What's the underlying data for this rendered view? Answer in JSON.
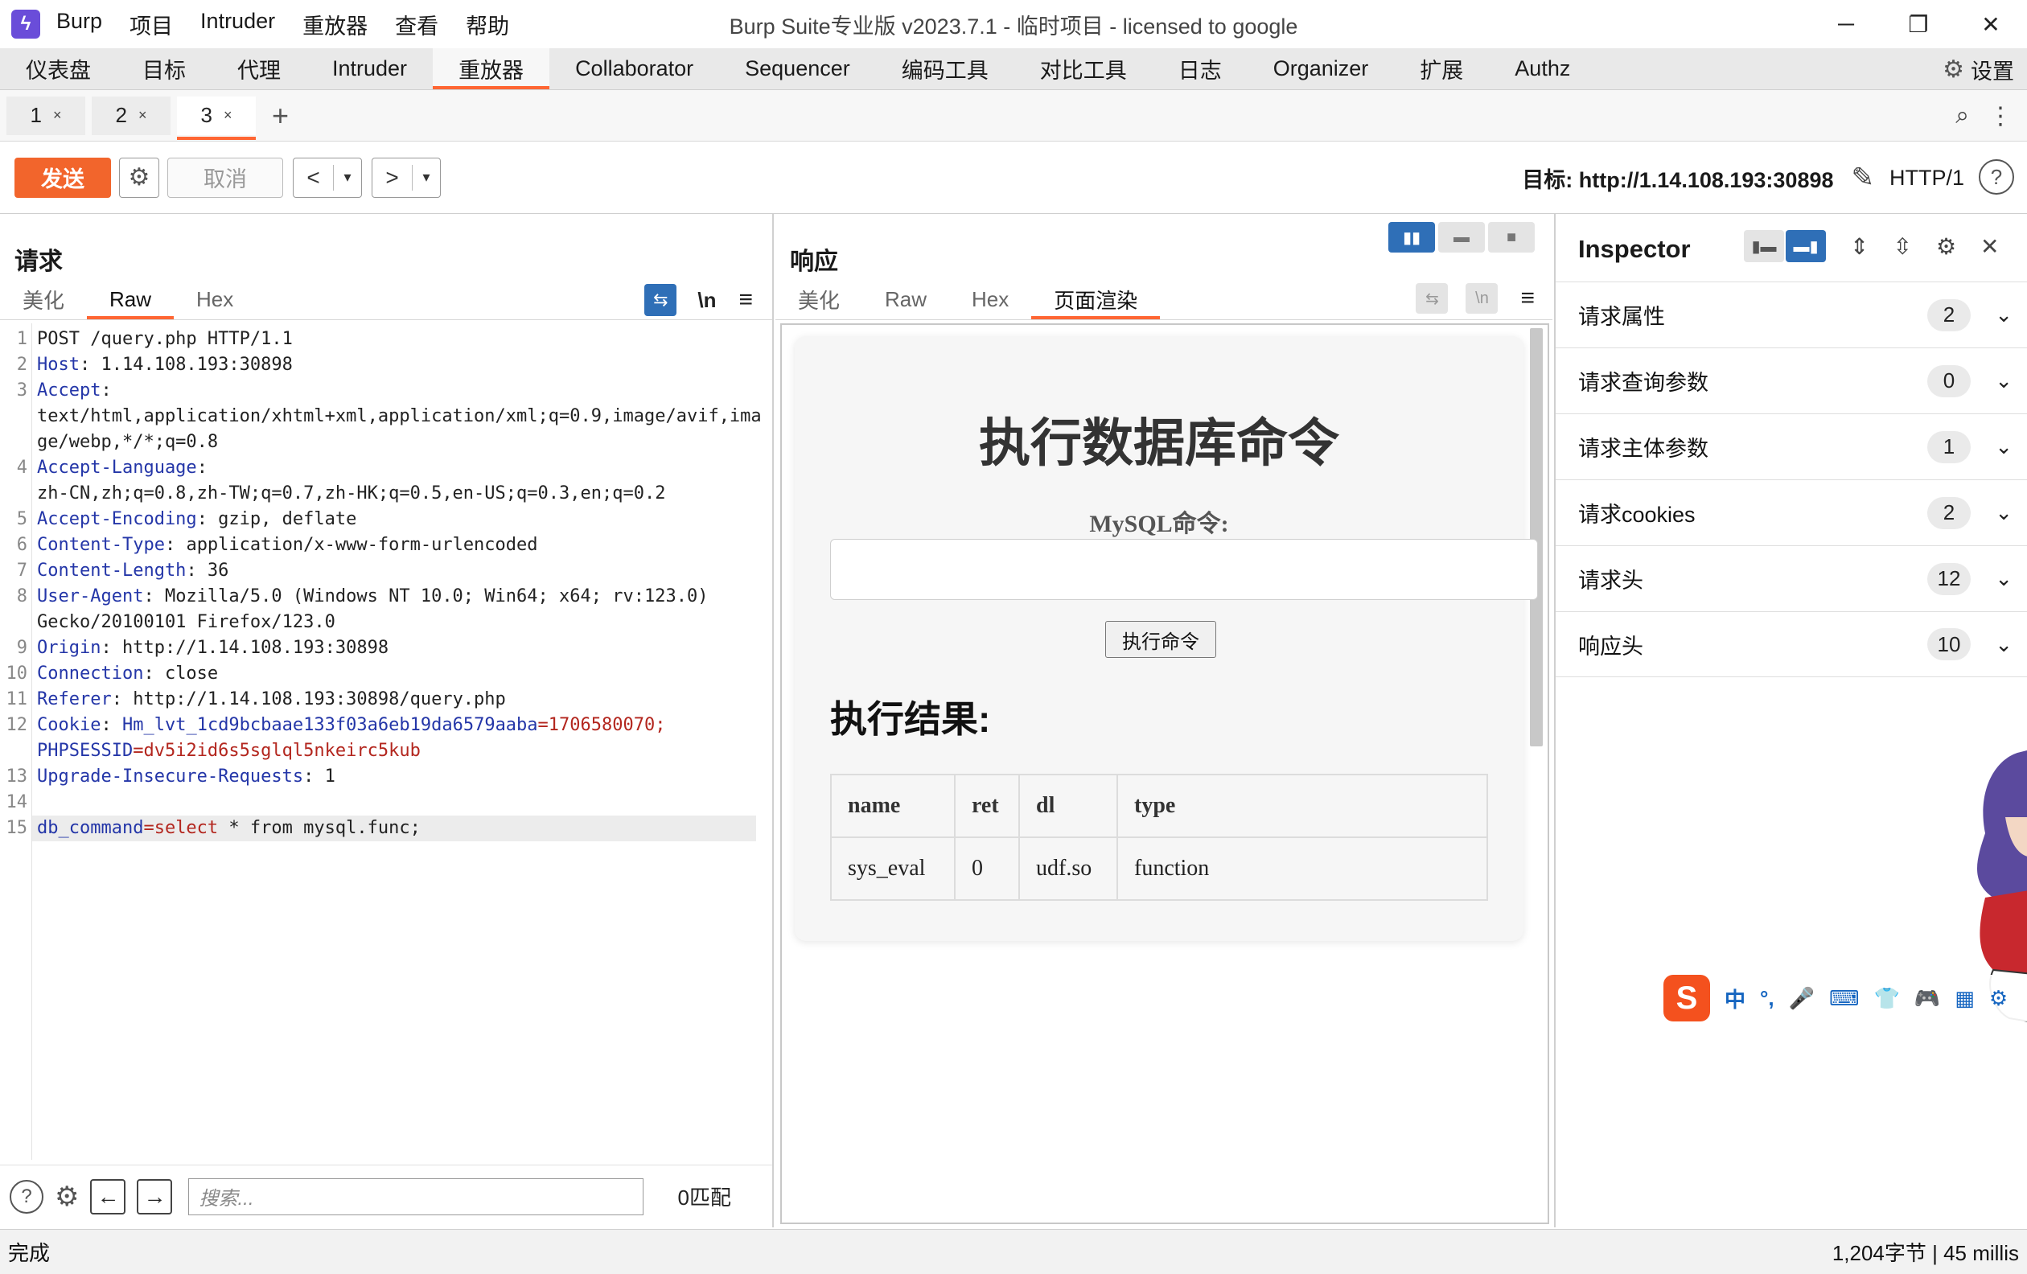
{
  "titlebar": {
    "app_icon": "burp-logo-icon",
    "menu": [
      "Burp",
      "项目",
      "Intruder",
      "重放器",
      "查看",
      "帮助"
    ],
    "window_title": "Burp Suite专业版  v2023.7.1 - 临时项目 - licensed to google",
    "controls": {
      "minimize": "─",
      "restore": "❐",
      "close": "✕"
    }
  },
  "main_tabs": [
    "仪表盘",
    "目标",
    "代理",
    "Intruder",
    "重放器",
    "Collaborator",
    "Sequencer",
    "编码工具",
    "对比工具",
    "日志",
    "Organizer",
    "扩展",
    "Authz"
  ],
  "main_tabs_active": "重放器",
  "settings_label": "设置",
  "repeater_tabs": [
    {
      "label": "1",
      "close": "×"
    },
    {
      "label": "2",
      "close": "×"
    },
    {
      "label": "3",
      "close": "×"
    }
  ],
  "repeater_add": "+",
  "toolbar": {
    "send": "发送",
    "cancel": "取消",
    "prev": "<",
    "next": ">",
    "dropdown": "▾",
    "target_label": "目标: http://1.14.108.193:30898",
    "http_version": "HTTP/1",
    "help": "?"
  },
  "request": {
    "title": "请求",
    "tabs": [
      "美化",
      "Raw",
      "Hex"
    ],
    "active_tab": "Raw",
    "tool_wrap": "⇆",
    "tool_newline": "\\n",
    "tool_menu": "≡",
    "lines": [
      {
        "n": "1",
        "text": "POST /query.php HTTP/1.1"
      },
      {
        "n": "2",
        "key": "Host",
        "val": ": 1.14.108.193:30898"
      },
      {
        "n": "3",
        "key": "Accept",
        "val": ":"
      },
      {
        "n": "",
        "text": "text/html,application/xhtml+xml,application/xml;q=0.9,image/avif,ima"
      },
      {
        "n": "",
        "text": "ge/webp,*/*;q=0.8"
      },
      {
        "n": "4",
        "key": "Accept-Language",
        "val": ":"
      },
      {
        "n": "",
        "text": "zh-CN,zh;q=0.8,zh-TW;q=0.7,zh-HK;q=0.5,en-US;q=0.3,en;q=0.2"
      },
      {
        "n": "5",
        "key": "Accept-Encoding",
        "val": ": gzip, deflate"
      },
      {
        "n": "6",
        "key": "Content-Type",
        "val": ": application/x-www-form-urlencoded"
      },
      {
        "n": "7",
        "key": "Content-Length",
        "val": ": 36"
      },
      {
        "n": "8",
        "key": "User-Agent",
        "val": ": Mozilla/5.0 (Windows NT 10.0; Win64; x64; rv:123.0)"
      },
      {
        "n": "",
        "text": "Gecko/20100101 Firefox/123.0"
      },
      {
        "n": "9",
        "key": "Origin",
        "val": ": http://1.14.108.193:30898"
      },
      {
        "n": "10",
        "key": "Connection",
        "val": ": close"
      },
      {
        "n": "11",
        "key": "Referer",
        "val": ": http://1.14.108.193:30898/query.php"
      },
      {
        "n": "12",
        "key": "Cookie",
        "val": ": ",
        "pk": "Hm_lvt_1cd9bcbaae133f03a6eb19da6579aaba",
        "pv": "=1706580070;"
      },
      {
        "n": "",
        "pk": "PHPSESSID",
        "pv": "=dv5i2id6s5sglql5nkeirc5kub"
      },
      {
        "n": "13",
        "key": "Upgrade-Insecure-Requests",
        "val": ": 1"
      },
      {
        "n": "14",
        "text": ""
      },
      {
        "n": "15",
        "pk": "db_command",
        "pv": "=select",
        "rest": " * from mysql.func;",
        "current": true
      }
    ],
    "footer": {
      "help": "?",
      "back": "←",
      "forward": "→",
      "search_placeholder": "搜索...",
      "matches": "0匹配"
    }
  },
  "response": {
    "title": "响应",
    "tabs": [
      "美化",
      "Raw",
      "Hex",
      "页面渲染"
    ],
    "active_tab": "页面渲染",
    "rendered": {
      "heading": "执行数据库命令",
      "mysql_label": "MySQL命令:",
      "exec_button": "执行命令",
      "result_heading": "执行结果:",
      "table_headers": [
        "name",
        "ret",
        "dl",
        "type"
      ],
      "table_rows": [
        [
          "sys_eval",
          "0",
          "udf.so",
          "function"
        ]
      ]
    }
  },
  "inspector": {
    "title": "Inspector",
    "sections": [
      {
        "label": "请求属性",
        "count": "2"
      },
      {
        "label": "请求查询参数",
        "count": "0"
      },
      {
        "label": "请求主体参数",
        "count": "1"
      },
      {
        "label": "请求cookies",
        "count": "2"
      },
      {
        "label": "请求头",
        "count": "12"
      },
      {
        "label": "响应头",
        "count": "10"
      }
    ]
  },
  "ime": {
    "logo": "S",
    "items": [
      "中",
      "°,",
      "🎤",
      "⌨",
      "👕",
      "🎮",
      "▦",
      "⚙"
    ]
  },
  "status": {
    "left": "完成",
    "right": "1,204字节 | 45 millis"
  },
  "colors": {
    "accent": "#ff6633",
    "send": "#f2652c",
    "active_blue": "#2f6fb7"
  }
}
